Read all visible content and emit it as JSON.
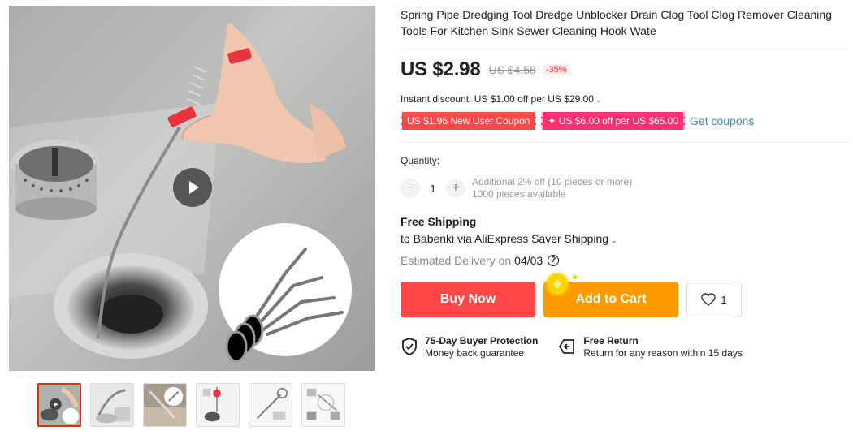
{
  "product": {
    "title": "Spring Pipe Dredging Tool Dredge Unblocker Drain Clog Tool Clog Remover Cleaning Tools For Kitchen Sink Sewer Cleaning Hook Wate",
    "price": "US $2.98",
    "original_price": "US $4.58",
    "discount": "-35%"
  },
  "promotions": {
    "instant_discount": "Instant discount: US $1.00 off per US $29.00",
    "coupons": [
      "US $1.96 New User Coupon",
      "✦ US $6.00 off per US $65.00"
    ],
    "get_coupons_label": "Get coupons"
  },
  "quantity": {
    "label": "Quantity:",
    "value": "1",
    "minus": "−",
    "plus": "+",
    "additional_offer": "Additional 2% off (10 pieces or more)",
    "available": "1000 pieces available"
  },
  "shipping": {
    "title": "Free Shipping",
    "destination": "to Babenki via AliExpress Saver Shipping",
    "delivery_prefix": "Estimated Delivery on",
    "delivery_date": "04/03",
    "help": "?"
  },
  "actions": {
    "buy_now": "Buy Now",
    "add_to_cart": "Add to Cart",
    "wishlist_count": "1"
  },
  "guarantees": [
    {
      "title": "75-Day Buyer Protection",
      "subtitle": "Money back guarantee",
      "icon": "shield-check-icon"
    },
    {
      "title": "Free Return",
      "subtitle": "Return for any reason within 15 days",
      "icon": "return-box-icon"
    }
  ],
  "gallery": {
    "thumbnail_count": 6,
    "active_thumbnail": 1
  },
  "colors": {
    "buy_now": "#ff4747",
    "add_to_cart": "#ff9900",
    "coupon_new_user": "#ff4747",
    "coupon_store": "#ff2e70",
    "link": "#3a8bbb"
  }
}
